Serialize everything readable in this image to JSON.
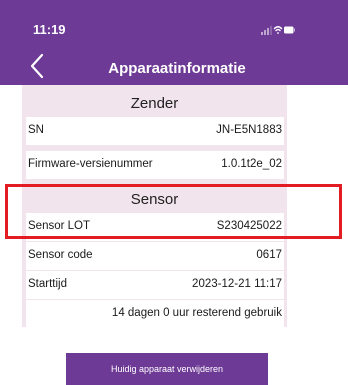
{
  "status_bar": {
    "time": "11:19"
  },
  "nav": {
    "title": "Apparaatinformatie",
    "back_icon": "chevron-left-icon"
  },
  "zender": {
    "header": "Zender",
    "rows": [
      {
        "label": "SN",
        "value": "JN-E5N1883"
      },
      {
        "label": "Firmware-versienummer",
        "value": "1.0.1t2e_02"
      }
    ]
  },
  "sensor": {
    "header": "Sensor",
    "rows": [
      {
        "label": "Sensor LOT",
        "value": "S230425022"
      },
      {
        "label": "Sensor code",
        "value": "0617"
      },
      {
        "label": "Starttijd",
        "value": "2023-12-21 11:17"
      }
    ],
    "remaining": "14 dagen 0 uur resterend gebruik"
  },
  "actions": {
    "remove_label": "Huidig apparaat verwijderen"
  },
  "colors": {
    "brand": "#6d3a96",
    "panel": "#f2e4ec",
    "highlight": "#e31b23"
  }
}
